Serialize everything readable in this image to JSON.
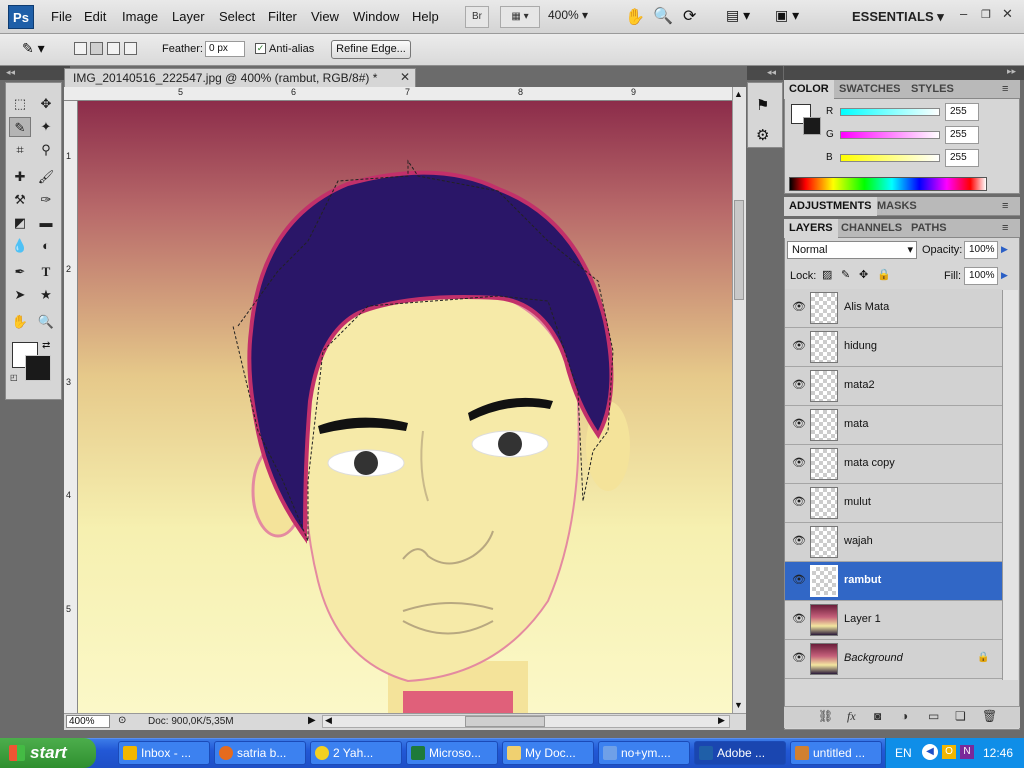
{
  "app": {
    "logo": "Ps"
  },
  "menu": [
    "File",
    "Edit",
    "Image",
    "Layer",
    "Select",
    "Filter",
    "View",
    "Window",
    "Help"
  ],
  "menubar": {
    "bridge_label": "Br",
    "zoom": "400%",
    "workspace": "ESSENTIALS"
  },
  "options": {
    "feather_label": "Feather:",
    "feather_value": "0 px",
    "antialias_label": "Anti-alias",
    "antialias_checked": true,
    "refine_label": "Refine Edge..."
  },
  "document": {
    "tab_title": "IMG_20140516_222547.jpg @ 400% (rambut, RGB/8#) *",
    "ruler_top": [
      "5",
      "6",
      "7",
      "8",
      "9"
    ],
    "ruler_left": [
      "1",
      "2",
      "3",
      "4",
      "5"
    ],
    "zoom": "400%",
    "doc_info": "Doc: 900,0K/5,35M"
  },
  "color_panel": {
    "tabs": [
      "COLOR",
      "SWATCHES",
      "STYLES"
    ],
    "r_label": "R",
    "r_value": "255",
    "g_label": "G",
    "g_value": "255",
    "b_label": "B",
    "b_value": "255"
  },
  "adjust_panel": {
    "tabs": [
      "ADJUSTMENTS",
      "MASKS"
    ]
  },
  "layers_panel": {
    "tabs": [
      "LAYERS",
      "CHANNELS",
      "PATHS"
    ],
    "blend_mode": "Normal",
    "opacity_label": "Opacity:",
    "opacity_value": "100%",
    "lock_label": "Lock:",
    "fill_label": "Fill:",
    "fill_value": "100%",
    "layers": [
      {
        "name": "Alis Mata"
      },
      {
        "name": "hidung"
      },
      {
        "name": "mata2"
      },
      {
        "name": "mata"
      },
      {
        "name": "mata copy"
      },
      {
        "name": "mulut"
      },
      {
        "name": "wajah"
      },
      {
        "name": "rambut",
        "selected": true
      },
      {
        "name": "Layer 1"
      },
      {
        "name": "Background"
      }
    ]
  },
  "taskbar": {
    "start_label": "start",
    "tasks": [
      "Inbox - ...",
      "satria b...",
      "2 Yah...",
      "Microso...",
      "My Doc...",
      "no+ym....",
      "Adobe ...",
      "untitled ..."
    ],
    "language": "EN",
    "clock": "12:46"
  },
  "colors": {
    "accent": "#3167c6",
    "taskbar": "#2258d6",
    "start": "#2f8f2f"
  }
}
